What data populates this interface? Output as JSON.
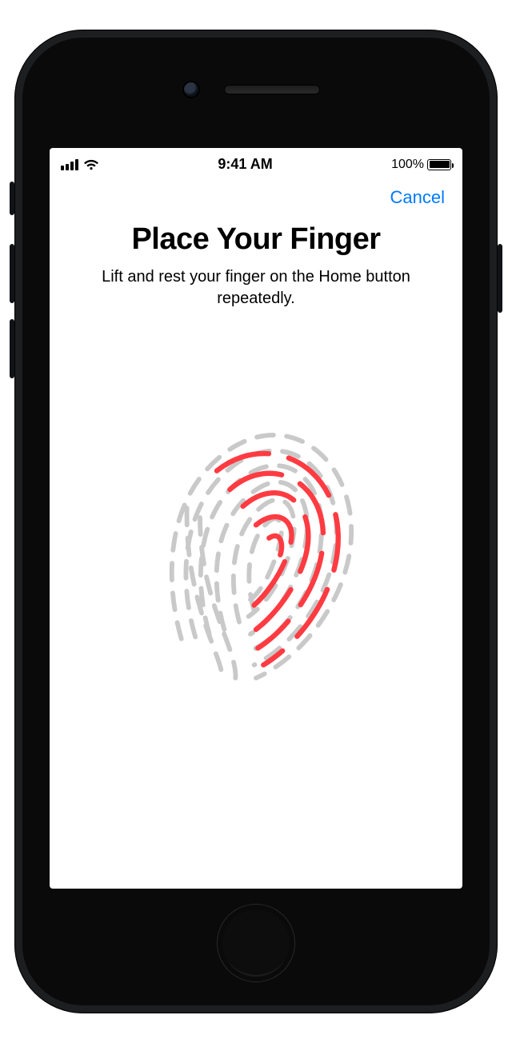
{
  "statusbar": {
    "time": "9:41 AM",
    "battery_label": "100%"
  },
  "navbar": {
    "cancel_label": "Cancel"
  },
  "page": {
    "title": "Place Your Finger",
    "subtitle": "Lift and rest your finger on the Home button repeatedly."
  },
  "colors": {
    "accent": "#007aff",
    "fingerprint_highlight": "#ff3b42",
    "fingerprint_base": "#c9c9c9"
  }
}
